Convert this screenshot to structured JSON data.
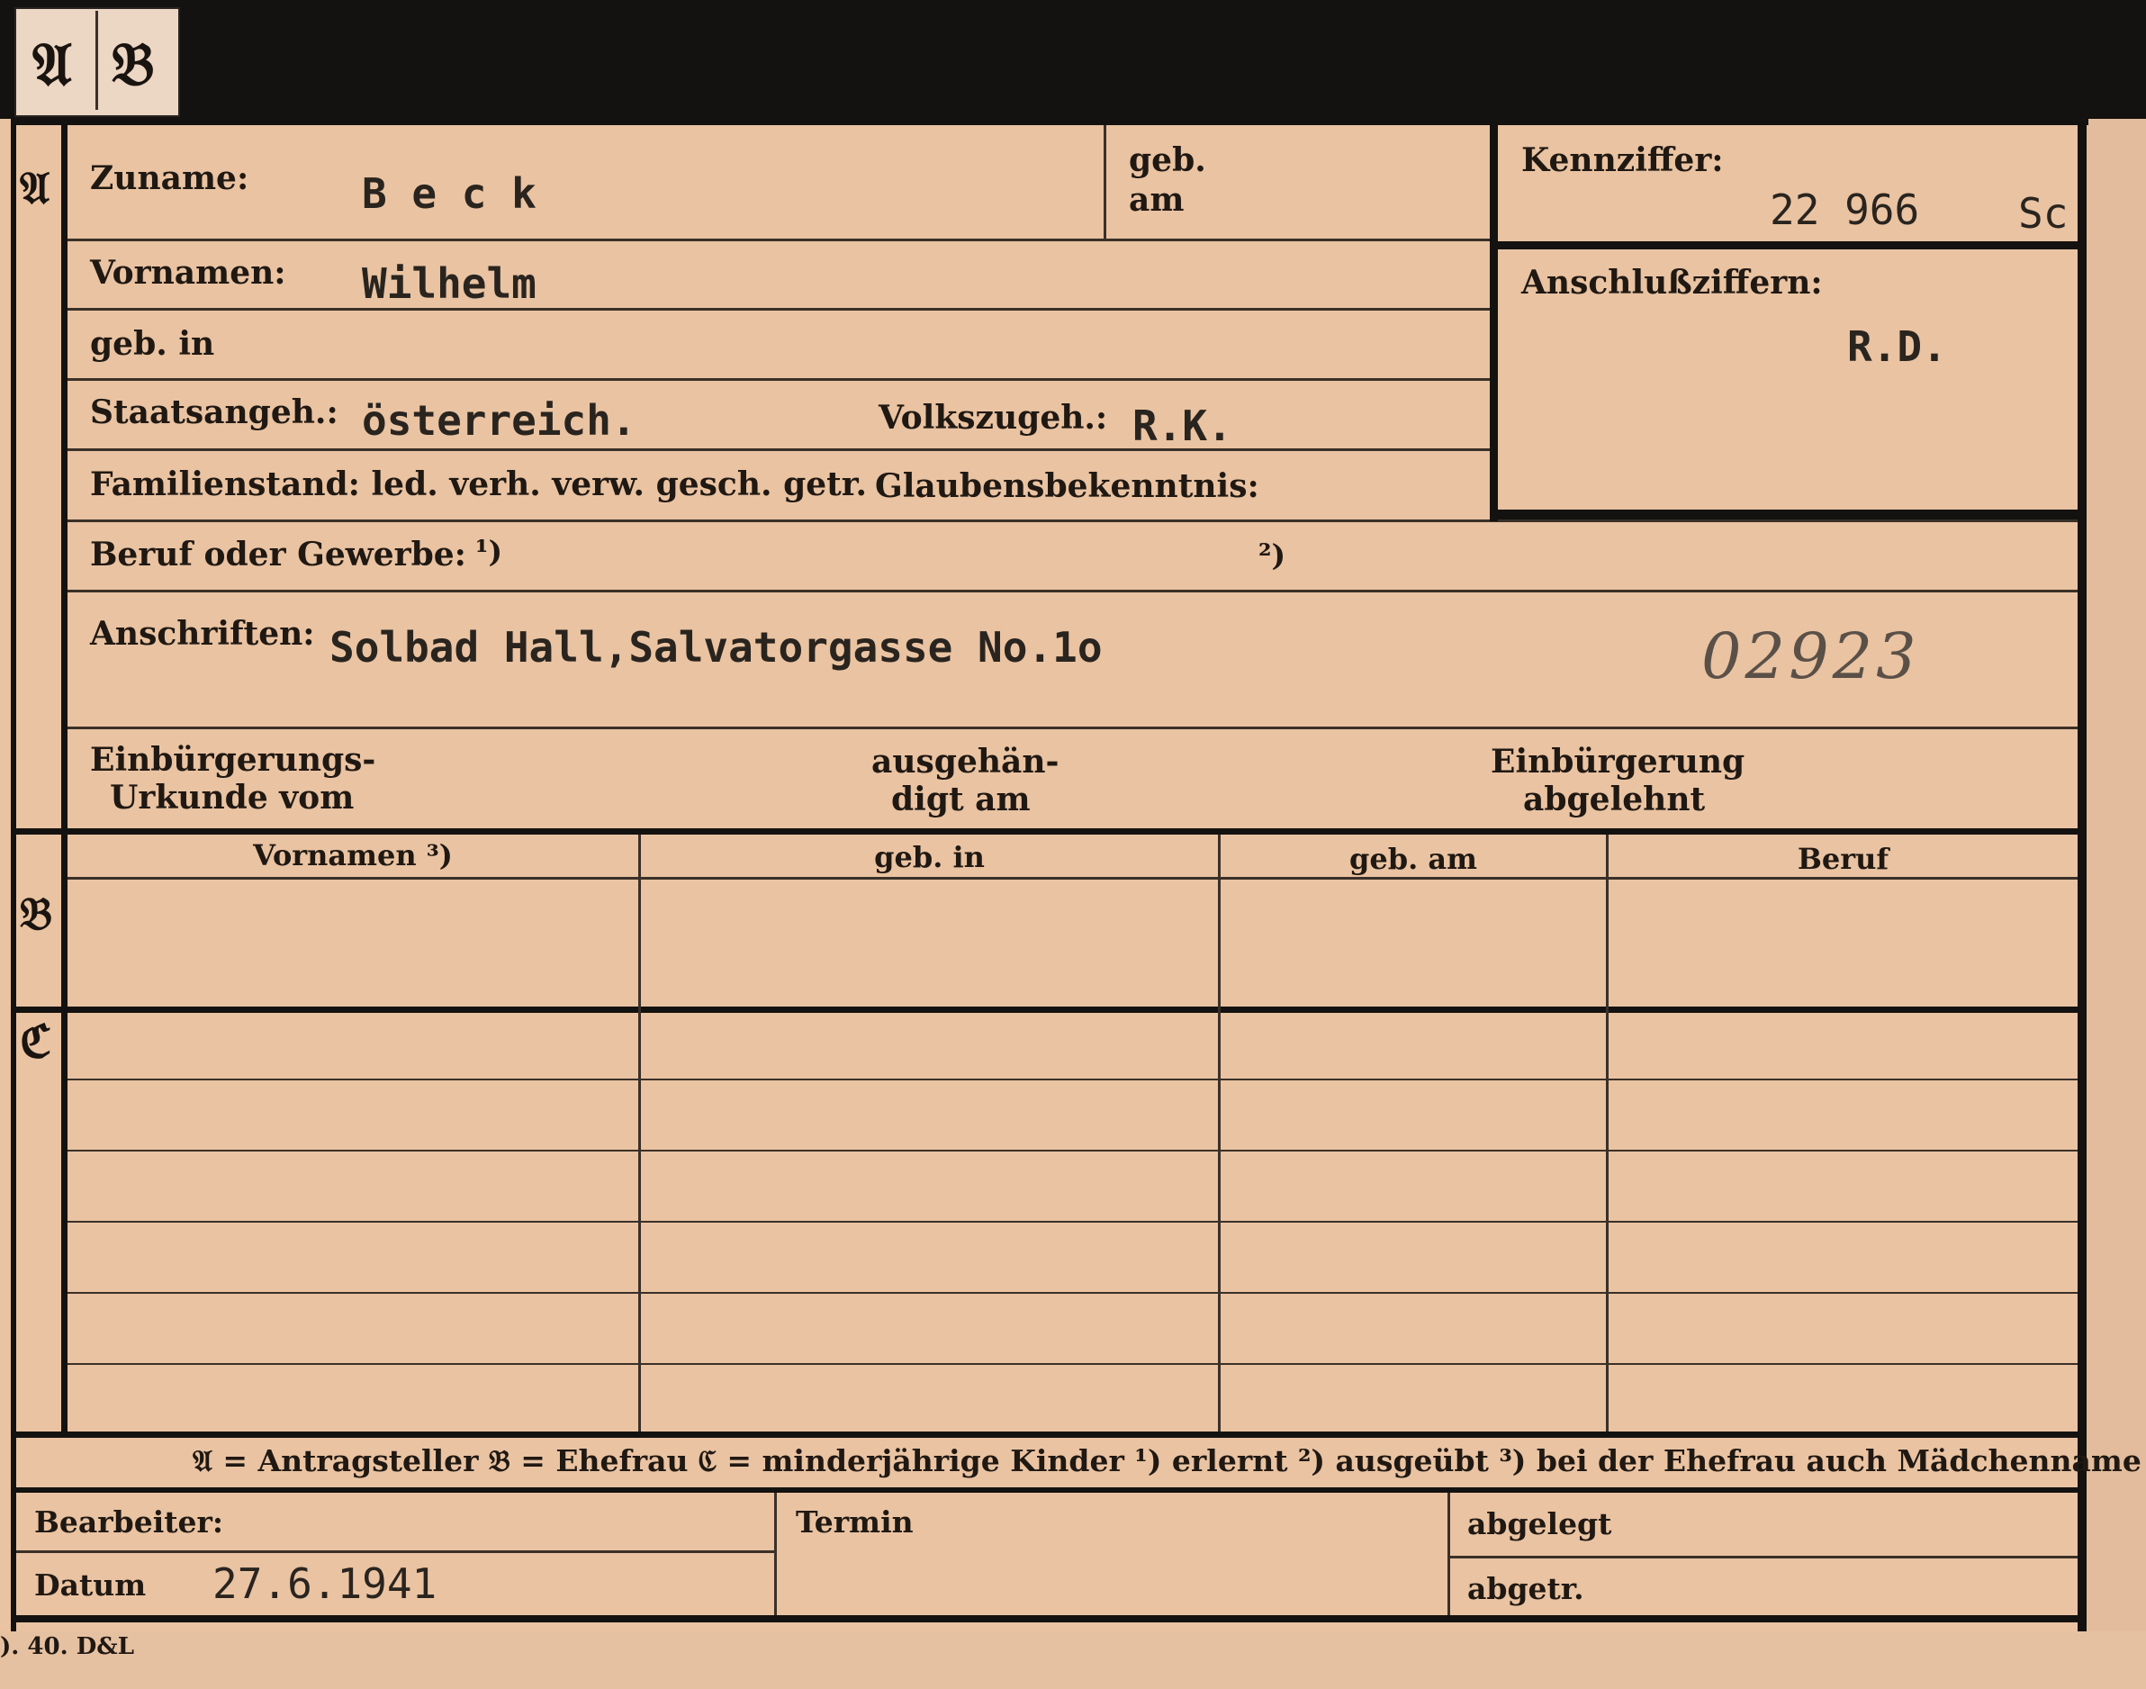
{
  "tabs": {
    "a": "𝔄",
    "b": "𝔅"
  },
  "sections": {
    "a": "𝔄",
    "b": "𝔅",
    "c": "ℭ"
  },
  "person": {
    "surname_label": "Zuname:",
    "surname_value": "B e c k",
    "born_on_label_1": "geb.",
    "born_on_label_2": "am",
    "firstnames_label": "Vornamen:",
    "firstnames_value": "Wilhelm",
    "birthplace_label": "geb. in",
    "nationality_label": "Staatsangeh.:",
    "nationality_value": "österreich.",
    "ethnicity_label": "Volkszugeh.:",
    "ethnicity_value": "R.K.",
    "marital_label": "Familienstand: led. verh. verw. gesch. getr.",
    "religion_label": "Glaubensbekenntnis:",
    "profession_label": "Beruf oder Gewerbe:",
    "profession_note1": "¹)",
    "profession_note2": "²)",
    "address_label": "Anschriften:",
    "address_value": "Solbad Hall,Salvatorgasse No.1o",
    "handwritten_number": "02923",
    "naturalization_deed_label_1": "Einbürgerungs-",
    "naturalization_deed_label_2": "Urkunde vom",
    "delivered_label_1": "ausgehän-",
    "delivered_label_2": "digt am",
    "naturalization_refused_label_1": "Einbürgerung",
    "naturalization_refused_label_2": "abgelehnt"
  },
  "reference": {
    "id_label": "Kennziffer:",
    "id_value": "22 966",
    "id_suffix": "Sc",
    "link_label": "Anschlußziffern:",
    "link_value": "R.D."
  },
  "family_table": {
    "headers": [
      "Vornamen ³)",
      "geb. in",
      "geb. am",
      "Beruf"
    ]
  },
  "legend": "𝔄 = Antragsteller   𝔅 = Ehefrau   ℭ = minderjährige Kinder   ¹) erlernt   ²) ausgeübt   ³) bei der Ehefrau auch Mädchenname",
  "footer": {
    "clerk_label": "Bearbeiter:",
    "date_label": "Datum",
    "date_value": "27.6.1941",
    "deadline_label": "Termin",
    "filed_label": "abgelegt",
    "sent_label": "abgetr.",
    "print_mark": "). 40. D&L"
  }
}
